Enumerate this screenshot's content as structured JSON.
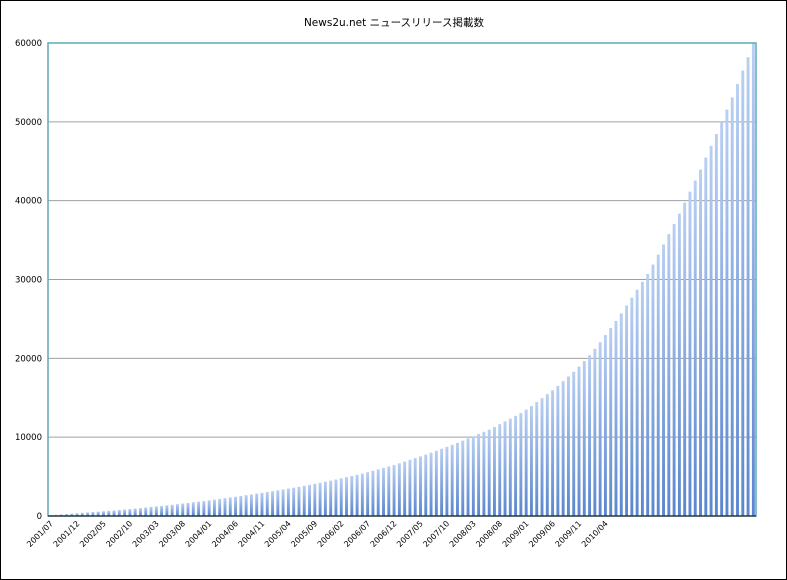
{
  "chart_data": {
    "type": "bar",
    "title": "News2u.net ニュースリリース掲載数",
    "xlabel": "",
    "ylabel": "",
    "ylim": [
      0,
      60000
    ],
    "yticks": [
      0,
      10000,
      20000,
      30000,
      40000,
      50000,
      60000
    ],
    "grid": true,
    "legend": "none",
    "colors": {
      "bar_top": "#b9cff2",
      "bar_bottom": "#5a86cf",
      "plot_border": "#5fa8b8",
      "grid": "#a0a0a0"
    },
    "x_start": "2001/07",
    "x_end": "2010/04",
    "x_tick_labels": [
      "2001/07",
      "2001/12",
      "2002/05",
      "2002/10",
      "2003/03",
      "2003/08",
      "2004/01",
      "2004/06",
      "2004/11",
      "2005/04",
      "2005/09",
      "2006/02",
      "2006/07",
      "2006/12",
      "2007/05",
      "2007/10",
      "2008/03",
      "2008/08",
      "2009/01",
      "2009/06",
      "2009/11",
      "2010/04"
    ],
    "values": [
      100,
      150,
      200,
      250,
      300,
      350,
      400,
      450,
      500,
      550,
      600,
      650,
      700,
      760,
      820,
      880,
      940,
      1000,
      1070,
      1140,
      1210,
      1280,
      1350,
      1420,
      1500,
      1580,
      1660,
      1740,
      1820,
      1900,
      1990,
      2080,
      2170,
      2260,
      2350,
      2440,
      2540,
      2640,
      2740,
      2840,
      2940,
      3040,
      3150,
      3260,
      3370,
      3480,
      3590,
      3700,
      3830,
      3960,
      4090,
      4220,
      4350,
      4480,
      4630,
      4780,
      4930,
      5080,
      5230,
      5380,
      5560,
      5740,
      5920,
      6100,
      6280,
      6460,
      6680,
      6900,
      7120,
      7340,
      7560,
      7780,
      8030,
      8280,
      8530,
      8780,
      9030,
      9280,
      9560,
      9840,
      10120,
      10400,
      10680,
      10960,
      11300,
      11650,
      12000,
      12350,
      12700,
      13050,
      13500,
      13950,
      14450,
      14950,
      15450,
      15950,
      16500,
      17100,
      17700,
      18300,
      18950,
      19650,
      20400,
      21200,
      22050,
      22950,
      23850,
      24750,
      25700,
      26700,
      27700,
      28700,
      29700,
      30700,
      31900,
      33150,
      34450,
      35750,
      37050,
      38350,
      39750,
      41150,
      42550,
      43950,
      45450,
      46950,
      48450,
      50000,
      51550,
      53100,
      54800,
      56500,
      58200,
      60000
    ]
  }
}
